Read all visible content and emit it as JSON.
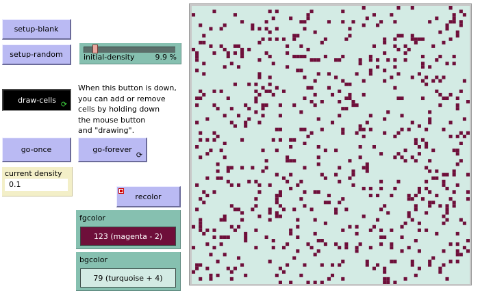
{
  "buttons": {
    "setup_blank": "setup-blank",
    "setup_random": "setup-random",
    "draw_cells": "draw-cells",
    "go_once": "go-once",
    "go_forever": "go-forever",
    "recolor": "recolor"
  },
  "slider": {
    "label": "initial-density",
    "value_text": "9.9 %",
    "value": 9.9,
    "min": 0,
    "max": 100
  },
  "note": {
    "lines": [
      "When this button is down,",
      "you can add or remove",
      "cells by holding down",
      "the mouse button",
      "and \"drawing\"."
    ]
  },
  "monitor": {
    "label": "current density",
    "value": "0.1"
  },
  "fgcolor": {
    "label": "fgcolor",
    "value": "123 (magenta - 2)",
    "color": "#6e0f3a"
  },
  "bgcolor": {
    "label": "bgcolor",
    "value": "79 (turquoise + 4)",
    "color": "#d3ebe4"
  },
  "world": {
    "cols": 80,
    "rows": 80,
    "density": 0.1,
    "cell_color": "#6e0f3a",
    "bg_color": "#d3ebe4"
  }
}
